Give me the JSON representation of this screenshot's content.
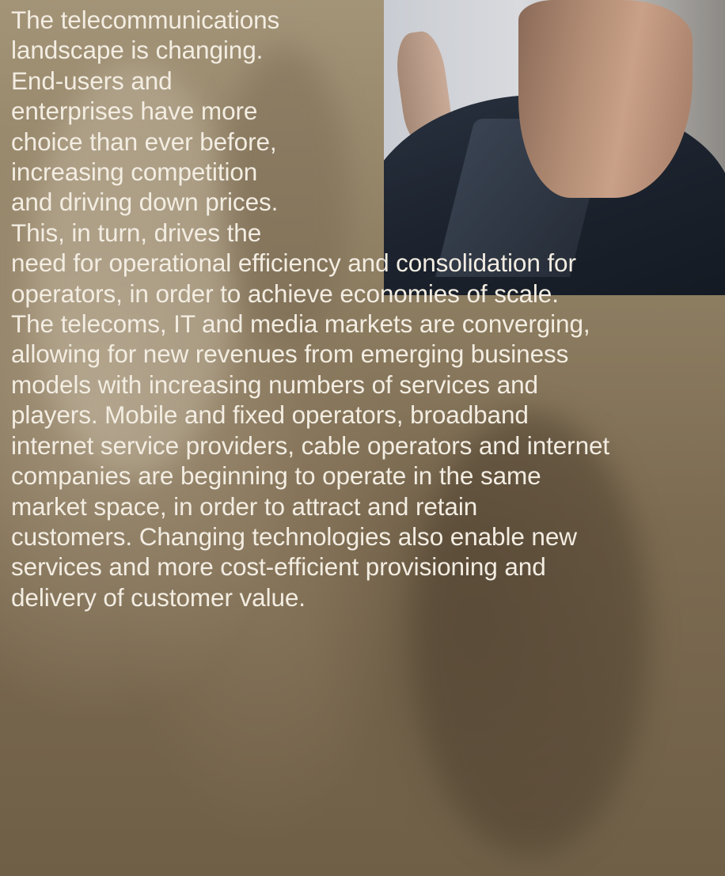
{
  "article": {
    "lines": [
      "The telecommunications",
      "landscape is changing.",
      "End-users and",
      "enterprises have more",
      "choice than ever before,",
      "increasing competition",
      "and driving down prices.",
      "This, in turn, drives the",
      "need for operational efficiency and consolidation for",
      "operators, in order to achieve economies of scale.",
      "The telecoms, IT and media markets are converging,",
      "allowing for new revenues from emerging business",
      "models with increasing numbers of services and",
      "players. Mobile and fixed operators, broadband",
      "internet service providers, cable operators and internet",
      "companies are beginning to operate in the same",
      "market space, in order to attract and retain",
      "customers. Changing technologies also enable new",
      "services and more cost-efficient provisioning and",
      "delivery of customer value."
    ]
  },
  "colors": {
    "background": "#7a6a53",
    "text": "#f3ede2"
  }
}
